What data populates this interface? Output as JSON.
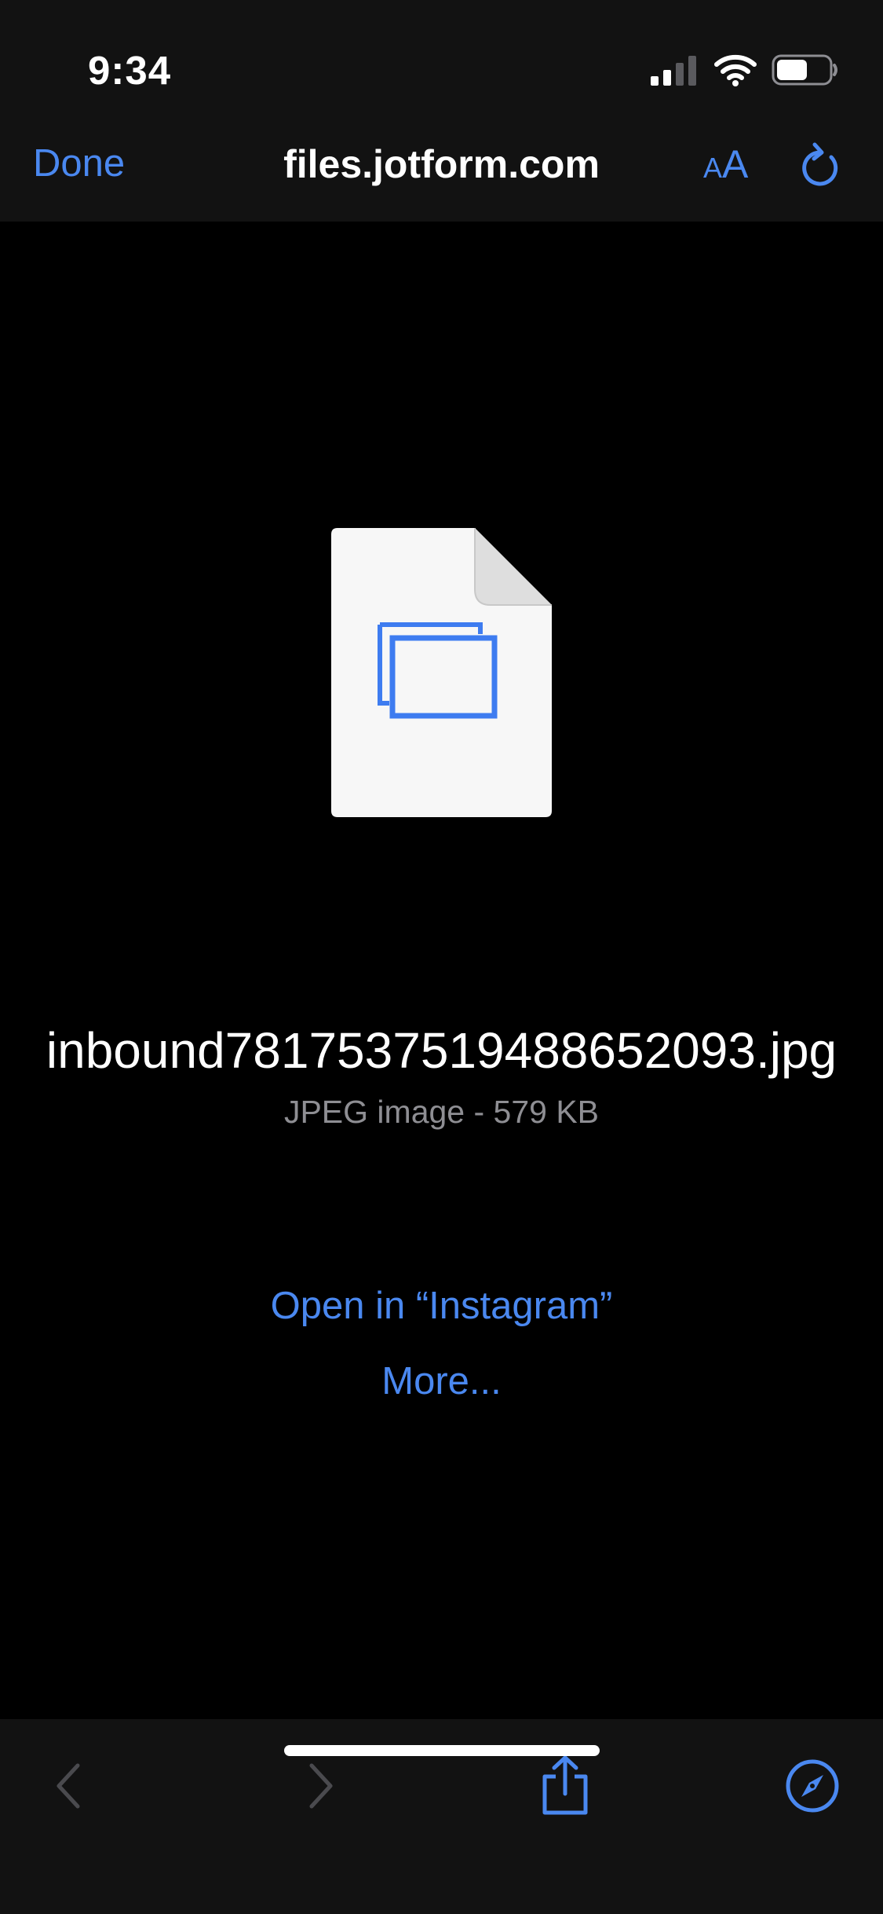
{
  "status_bar": {
    "time": "9:34",
    "icons": [
      "cellular-signal-icon",
      "wifi-icon",
      "battery-icon"
    ]
  },
  "nav": {
    "done_label": "Done",
    "title": "files.jotform.com",
    "text_size_small": "A",
    "text_size_large": "A",
    "reload_icon": "reload-icon"
  },
  "file": {
    "icon": "image-file-icon",
    "name": "inbound7817537519488652093.jpg",
    "meta": "JPEG image - 579 KB"
  },
  "actions": {
    "open_in": "Open in “Instagram”",
    "more": "More..."
  },
  "toolbar": {
    "icons": [
      "back-arrow-icon",
      "forward-arrow-icon",
      "share-icon",
      "compass-icon"
    ]
  },
  "colors": {
    "accent": "#4a88f0",
    "bar_background": "#121212",
    "background": "#000000",
    "secondary_text": "#8e8e93",
    "disabled_icon": "#4a4a4e"
  }
}
